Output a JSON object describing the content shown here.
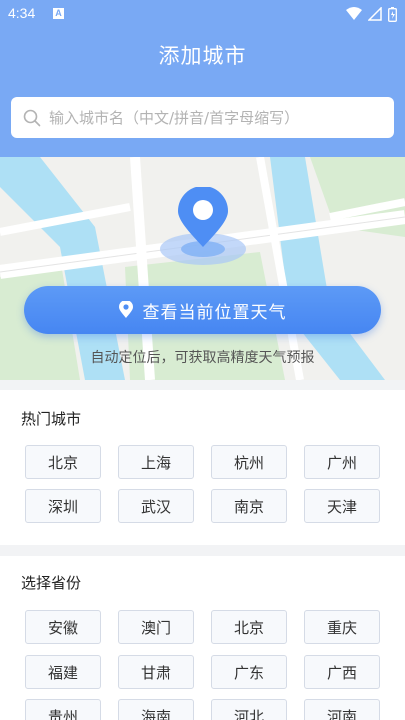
{
  "status": {
    "time": "4:34",
    "notif_glyph": "A"
  },
  "header": {
    "title": "添加城市"
  },
  "search": {
    "placeholder": "输入城市名（中文/拼音/首字母缩写）"
  },
  "locate": {
    "button_label": "查看当前位置天气",
    "hint": "自动定位后，可获取高精度天气预报"
  },
  "hot_cities": {
    "title": "热门城市",
    "items": [
      "北京",
      "上海",
      "杭州",
      "广州",
      "深圳",
      "武汉",
      "南京",
      "天津"
    ]
  },
  "provinces": {
    "title": "选择省份",
    "items": [
      "安徽",
      "澳门",
      "北京",
      "重庆",
      "福建",
      "甘肃",
      "广东",
      "广西",
      "贵州",
      "海南",
      "河北",
      "河南"
    ]
  },
  "colors": {
    "header": "#79a9f4",
    "button": "#4686f2",
    "map_water": "#aee0f5",
    "map_green": "#d8ecd2"
  }
}
